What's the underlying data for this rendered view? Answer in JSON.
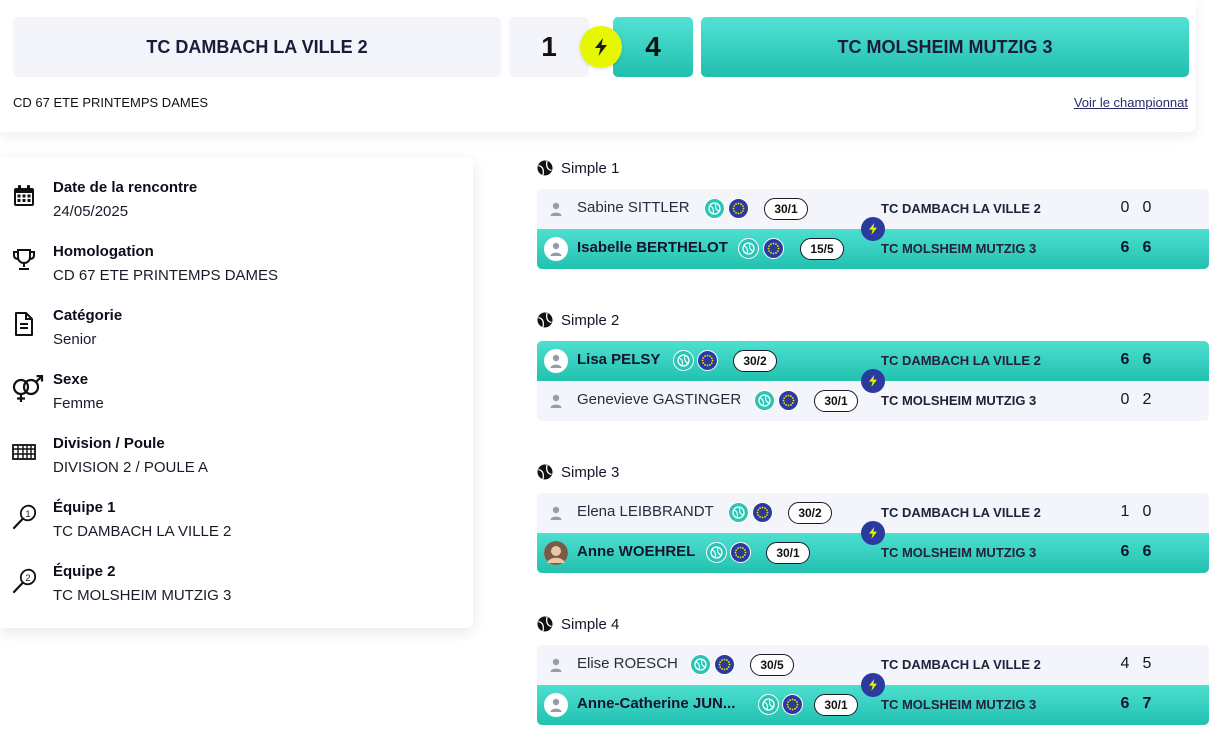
{
  "header": {
    "home_team": "TC DAMBACH LA VILLE 2",
    "away_team": "TC MOLSHEIM MUTZIG 3",
    "home_score": "1",
    "away_score": "4",
    "competition": "CD 67 ETE PRINTEMPS DAMES",
    "link": "Voir le championnat"
  },
  "info": [
    {
      "icon": "calendar-icon",
      "label": "Date de la rencontre",
      "value": "24/05/2025"
    },
    {
      "icon": "trophy-icon",
      "label": "Homologation",
      "value": "CD 67 ETE PRINTEMPS DAMES"
    },
    {
      "icon": "document-icon",
      "label": "Catégorie",
      "value": "Senior"
    },
    {
      "icon": "gender-icon",
      "label": "Sexe",
      "value": "Femme"
    },
    {
      "icon": "grid-icon",
      "label": "Division / Poule",
      "value": "DIVISION 2 / POULE A"
    },
    {
      "icon": "racket-1-icon",
      "label": "Équipe 1",
      "value": "TC DAMBACH LA VILLE 2"
    },
    {
      "icon": "racket-2-icon",
      "label": "Équipe 2",
      "value": "TC MOLSHEIM MUTZIG 3"
    }
  ],
  "matches": [
    {
      "title": "Simple 1",
      "rows": [
        {
          "player": "Sabine SITTLER",
          "rank": "30/1",
          "team": "TC DAMBACH LA VILLE 2",
          "s1": "0",
          "s2": "0",
          "winner": false,
          "photo": false
        },
        {
          "player": "Isabelle BERTHELOT",
          "rank": "15/5",
          "team": "TC MOLSHEIM MUTZIG 3",
          "s1": "6",
          "s2": "6",
          "winner": true,
          "photo": false
        }
      ]
    },
    {
      "title": "Simple 2",
      "rows": [
        {
          "player": "Lisa PELSY",
          "rank": "30/2",
          "team": "TC DAMBACH LA VILLE 2",
          "s1": "6",
          "s2": "6",
          "winner": true,
          "photo": false
        },
        {
          "player": "Genevieve GASTINGER",
          "rank": "30/1",
          "team": "TC MOLSHEIM MUTZIG 3",
          "s1": "0",
          "s2": "2",
          "winner": false,
          "photo": false
        }
      ]
    },
    {
      "title": "Simple 3",
      "rows": [
        {
          "player": "Elena LEIBBRANDT",
          "rank": "30/2",
          "team": "TC DAMBACH LA VILLE 2",
          "s1": "1",
          "s2": "0",
          "winner": false,
          "photo": false
        },
        {
          "player": "Anne WOEHREL",
          "rank": "30/1",
          "team": "TC MOLSHEIM MUTZIG 3",
          "s1": "6",
          "s2": "6",
          "winner": true,
          "photo": true
        }
      ]
    },
    {
      "title": "Simple 4",
      "rows": [
        {
          "player": "Elise ROESCH",
          "rank": "30/5",
          "team": "TC DAMBACH LA VILLE 2",
          "s1": "4",
          "s2": "5",
          "winner": false,
          "photo": false
        },
        {
          "player": "Anne-Catherine JUN...",
          "rank": "30/1",
          "team": "TC MOLSHEIM MUTZIG 3",
          "s1": "6",
          "s2": "7",
          "winner": true,
          "photo": false
        }
      ]
    }
  ],
  "colors": {
    "accent_teal": "#2bc5b4",
    "bolt_yellow": "#e7f700",
    "navy": "#2b3a9e",
    "light_bg": "#f4f4fb"
  }
}
